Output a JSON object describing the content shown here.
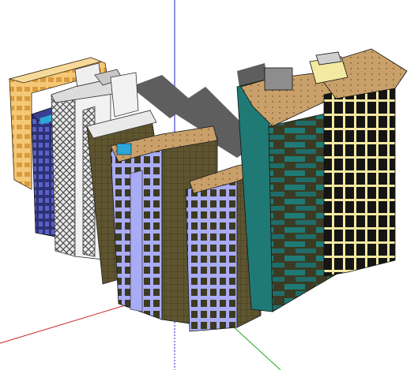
{
  "scene": {
    "background": "#ffffff",
    "axes": {
      "x_color": "#cc2222",
      "y_color": "#22aa22",
      "z_color": "#2222cc"
    },
    "shadow_color": "#5e5e5e",
    "palette": {
      "orange_facade": "#f4c877",
      "dark_blue": "#3a3f92",
      "lavender": "#a9acf5",
      "white": "#f2f2f2",
      "olive_dark": "#3c3a1f",
      "olive": "#6b6136",
      "sand_roof": "#c9a06a",
      "teal": "#1f7a75",
      "teal_dark": "#16544f",
      "cream": "#f3e9a0",
      "black": "#1a1a1a",
      "gray_block": "#9a9a9a",
      "cyan": "#2aa8d8"
    },
    "buildings": [
      {
        "id": "orange",
        "name": "orange-tower"
      },
      {
        "id": "dark-blue",
        "name": "dark-blue-tower"
      },
      {
        "id": "white-grid",
        "name": "white-grid-tower"
      },
      {
        "id": "lavender-left",
        "name": "lavender-tower-left"
      },
      {
        "id": "lavender-right",
        "name": "lavender-tower-right"
      },
      {
        "id": "teal",
        "name": "teal-tower"
      },
      {
        "id": "cream",
        "name": "cream-black-tower"
      }
    ]
  }
}
